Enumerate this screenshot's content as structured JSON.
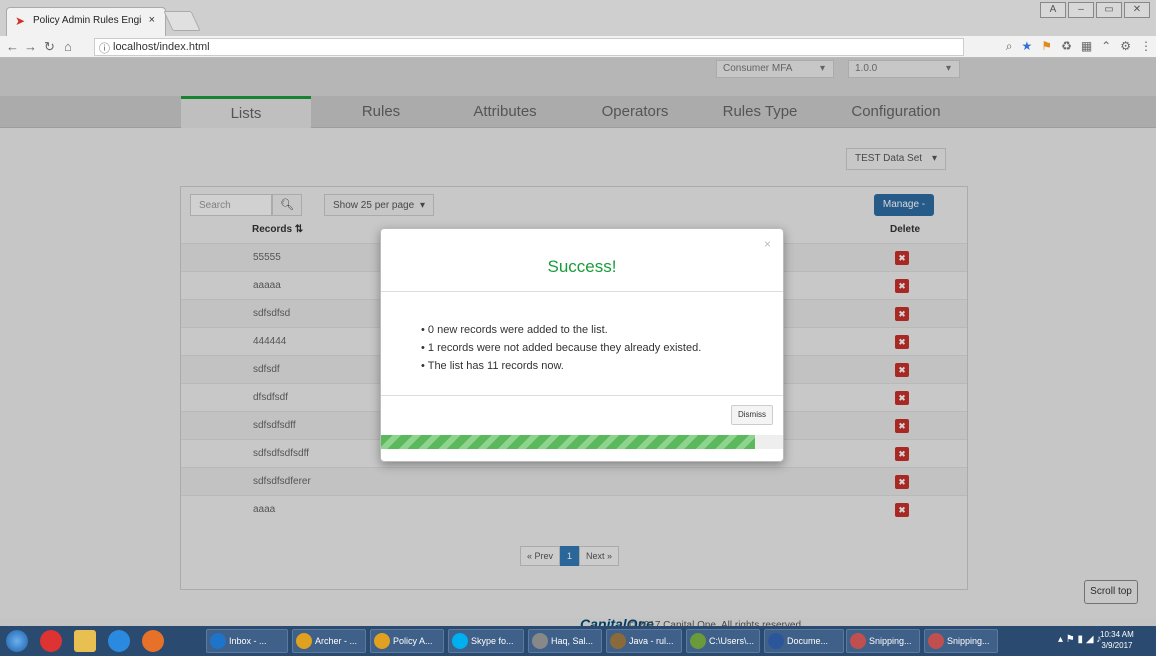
{
  "browser": {
    "tab_title": "Policy Admin Rules Engi",
    "tab_close": "×",
    "url": "localhost/index.html",
    "window_controls": [
      "A",
      "–",
      "▭",
      "✕"
    ]
  },
  "topbar": {
    "app_select": "Consumer MFA",
    "version_select": "1.0.0"
  },
  "nav": {
    "tabs": [
      "Lists",
      "Rules",
      "Attributes",
      "Operators",
      "Rules Type",
      "Configuration"
    ]
  },
  "dataset": "TEST Data Set",
  "toolbar": {
    "search_placeholder": "Search",
    "per_page": "Show 25 per page",
    "manage": "Manage -"
  },
  "table": {
    "col_records": "Records ⇅",
    "col_delete": "Delete",
    "rows": [
      "55555",
      "aaaaa",
      "sdfsdfsd",
      "444444",
      "sdfsdf",
      "dfsdfsdf",
      "sdfsdfsdff",
      "sdfsdfsdfsdff",
      "sdfsdfsdferer",
      "aaaa"
    ]
  },
  "pager": {
    "prev": "« Prev",
    "page": "1",
    "next": "Next »"
  },
  "footer": {
    "logo": "CapitalOne",
    "copyright": "© 2017 Capital One. All rights reserved."
  },
  "scroll_top": "Scroll top",
  "modal": {
    "title": "Success!",
    "close": "×",
    "messages": [
      "0 new records were added to the list.",
      "1 records were not added because they already existed.",
      "The list has 11 records now."
    ],
    "dismiss": "Dismiss",
    "progress_fraction": 0.93
  },
  "taskbar": {
    "buttons": [
      "Inbox - ...",
      "Archer - ...",
      "Policy A...",
      "Skype fo...",
      "Haq, Sal...",
      "Java - rul...",
      "C:\\Users\\...",
      "Docume...",
      "Snipping...",
      "Snipping..."
    ],
    "time": "10:34 AM",
    "date": "3/9/2017"
  },
  "colors": {
    "success": "#1a9c3a",
    "primary": "#2e6da4",
    "danger": "#c9302c"
  }
}
